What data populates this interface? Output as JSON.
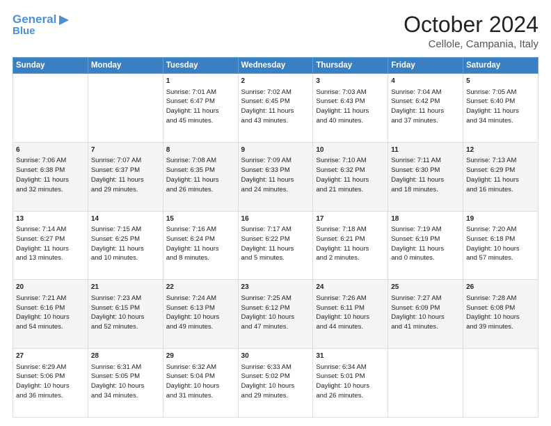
{
  "header": {
    "logo_general": "General",
    "logo_blue": "Blue",
    "title": "October 2024",
    "subtitle": "Cellole, Campania, Italy"
  },
  "calendar": {
    "headers": [
      "Sunday",
      "Monday",
      "Tuesday",
      "Wednesday",
      "Thursday",
      "Friday",
      "Saturday"
    ],
    "rows": [
      [
        {
          "day": "",
          "lines": []
        },
        {
          "day": "",
          "lines": []
        },
        {
          "day": "1",
          "lines": [
            "Sunrise: 7:01 AM",
            "Sunset: 6:47 PM",
            "Daylight: 11 hours",
            "and 45 minutes."
          ]
        },
        {
          "day": "2",
          "lines": [
            "Sunrise: 7:02 AM",
            "Sunset: 6:45 PM",
            "Daylight: 11 hours",
            "and 43 minutes."
          ]
        },
        {
          "day": "3",
          "lines": [
            "Sunrise: 7:03 AM",
            "Sunset: 6:43 PM",
            "Daylight: 11 hours",
            "and 40 minutes."
          ]
        },
        {
          "day": "4",
          "lines": [
            "Sunrise: 7:04 AM",
            "Sunset: 6:42 PM",
            "Daylight: 11 hours",
            "and 37 minutes."
          ]
        },
        {
          "day": "5",
          "lines": [
            "Sunrise: 7:05 AM",
            "Sunset: 6:40 PM",
            "Daylight: 11 hours",
            "and 34 minutes."
          ]
        }
      ],
      [
        {
          "day": "6",
          "lines": [
            "Sunrise: 7:06 AM",
            "Sunset: 6:38 PM",
            "Daylight: 11 hours",
            "and 32 minutes."
          ]
        },
        {
          "day": "7",
          "lines": [
            "Sunrise: 7:07 AM",
            "Sunset: 6:37 PM",
            "Daylight: 11 hours",
            "and 29 minutes."
          ]
        },
        {
          "day": "8",
          "lines": [
            "Sunrise: 7:08 AM",
            "Sunset: 6:35 PM",
            "Daylight: 11 hours",
            "and 26 minutes."
          ]
        },
        {
          "day": "9",
          "lines": [
            "Sunrise: 7:09 AM",
            "Sunset: 6:33 PM",
            "Daylight: 11 hours",
            "and 24 minutes."
          ]
        },
        {
          "day": "10",
          "lines": [
            "Sunrise: 7:10 AM",
            "Sunset: 6:32 PM",
            "Daylight: 11 hours",
            "and 21 minutes."
          ]
        },
        {
          "day": "11",
          "lines": [
            "Sunrise: 7:11 AM",
            "Sunset: 6:30 PM",
            "Daylight: 11 hours",
            "and 18 minutes."
          ]
        },
        {
          "day": "12",
          "lines": [
            "Sunrise: 7:13 AM",
            "Sunset: 6:29 PM",
            "Daylight: 11 hours",
            "and 16 minutes."
          ]
        }
      ],
      [
        {
          "day": "13",
          "lines": [
            "Sunrise: 7:14 AM",
            "Sunset: 6:27 PM",
            "Daylight: 11 hours",
            "and 13 minutes."
          ]
        },
        {
          "day": "14",
          "lines": [
            "Sunrise: 7:15 AM",
            "Sunset: 6:25 PM",
            "Daylight: 11 hours",
            "and 10 minutes."
          ]
        },
        {
          "day": "15",
          "lines": [
            "Sunrise: 7:16 AM",
            "Sunset: 6:24 PM",
            "Daylight: 11 hours",
            "and 8 minutes."
          ]
        },
        {
          "day": "16",
          "lines": [
            "Sunrise: 7:17 AM",
            "Sunset: 6:22 PM",
            "Daylight: 11 hours",
            "and 5 minutes."
          ]
        },
        {
          "day": "17",
          "lines": [
            "Sunrise: 7:18 AM",
            "Sunset: 6:21 PM",
            "Daylight: 11 hours",
            "and 2 minutes."
          ]
        },
        {
          "day": "18",
          "lines": [
            "Sunrise: 7:19 AM",
            "Sunset: 6:19 PM",
            "Daylight: 11 hours",
            "and 0 minutes."
          ]
        },
        {
          "day": "19",
          "lines": [
            "Sunrise: 7:20 AM",
            "Sunset: 6:18 PM",
            "Daylight: 10 hours",
            "and 57 minutes."
          ]
        }
      ],
      [
        {
          "day": "20",
          "lines": [
            "Sunrise: 7:21 AM",
            "Sunset: 6:16 PM",
            "Daylight: 10 hours",
            "and 54 minutes."
          ]
        },
        {
          "day": "21",
          "lines": [
            "Sunrise: 7:23 AM",
            "Sunset: 6:15 PM",
            "Daylight: 10 hours",
            "and 52 minutes."
          ]
        },
        {
          "day": "22",
          "lines": [
            "Sunrise: 7:24 AM",
            "Sunset: 6:13 PM",
            "Daylight: 10 hours",
            "and 49 minutes."
          ]
        },
        {
          "day": "23",
          "lines": [
            "Sunrise: 7:25 AM",
            "Sunset: 6:12 PM",
            "Daylight: 10 hours",
            "and 47 minutes."
          ]
        },
        {
          "day": "24",
          "lines": [
            "Sunrise: 7:26 AM",
            "Sunset: 6:11 PM",
            "Daylight: 10 hours",
            "and 44 minutes."
          ]
        },
        {
          "day": "25",
          "lines": [
            "Sunrise: 7:27 AM",
            "Sunset: 6:09 PM",
            "Daylight: 10 hours",
            "and 41 minutes."
          ]
        },
        {
          "day": "26",
          "lines": [
            "Sunrise: 7:28 AM",
            "Sunset: 6:08 PM",
            "Daylight: 10 hours",
            "and 39 minutes."
          ]
        }
      ],
      [
        {
          "day": "27",
          "lines": [
            "Sunrise: 6:29 AM",
            "Sunset: 5:06 PM",
            "Daylight: 10 hours",
            "and 36 minutes."
          ]
        },
        {
          "day": "28",
          "lines": [
            "Sunrise: 6:31 AM",
            "Sunset: 5:05 PM",
            "Daylight: 10 hours",
            "and 34 minutes."
          ]
        },
        {
          "day": "29",
          "lines": [
            "Sunrise: 6:32 AM",
            "Sunset: 5:04 PM",
            "Daylight: 10 hours",
            "and 31 minutes."
          ]
        },
        {
          "day": "30",
          "lines": [
            "Sunrise: 6:33 AM",
            "Sunset: 5:02 PM",
            "Daylight: 10 hours",
            "and 29 minutes."
          ]
        },
        {
          "day": "31",
          "lines": [
            "Sunrise: 6:34 AM",
            "Sunset: 5:01 PM",
            "Daylight: 10 hours",
            "and 26 minutes."
          ]
        },
        {
          "day": "",
          "lines": []
        },
        {
          "day": "",
          "lines": []
        }
      ]
    ]
  }
}
